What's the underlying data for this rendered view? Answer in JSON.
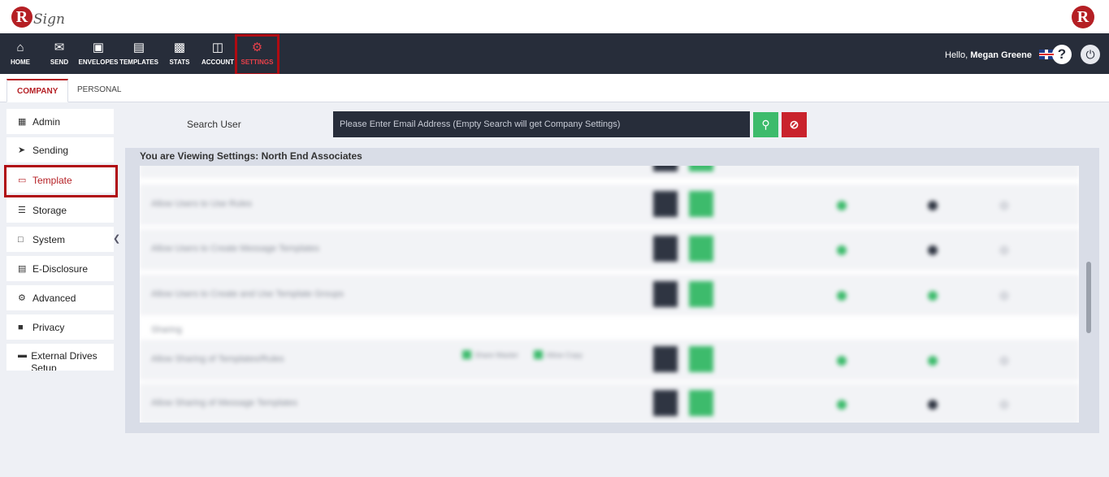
{
  "brand": {
    "logo_letter": "R",
    "logo_text": "Sign",
    "corner_letter": "R",
    "accent": "#b51f24",
    "nav_bg": "#272d3a",
    "green": "#3dbb6c"
  },
  "nav": {
    "home": "HOME",
    "send": "SEND",
    "envelopes": "ENVELOPES",
    "templates": "TEMPLATES",
    "stats": "STATS",
    "account": "ACCOUNT",
    "settings": "SETTINGS"
  },
  "user": {
    "hello": "Hello,",
    "name": "Megan Greene"
  },
  "tabs": {
    "company": "COMPANY",
    "personal": "PERSONAL"
  },
  "sidebar": {
    "admin": "Admin",
    "sending": "Sending",
    "template": "Template",
    "storage": "Storage",
    "system": "System",
    "edisclosure": "E-Disclosure",
    "advanced": "Advanced",
    "privacy": "Privacy",
    "external": "External Drives Setup"
  },
  "search": {
    "label": "Search User",
    "placeholder": "Please Enter Email Address (Empty Search will get Company Settings)"
  },
  "panel": {
    "title": "You are Viewing Settings: North End Associates"
  },
  "rows": {
    "r1": "Allow Users to Use Rules",
    "r2": "Allow Users to Create Message Templates",
    "r3": "Allow Users to Create and Use Template Groups",
    "section": "Sharing",
    "r4": "Allow Sharing of Templates/Rules",
    "r5": "Allow Sharing of Message Templates",
    "opt1": "Share Master",
    "opt2": "Allow Copy"
  }
}
